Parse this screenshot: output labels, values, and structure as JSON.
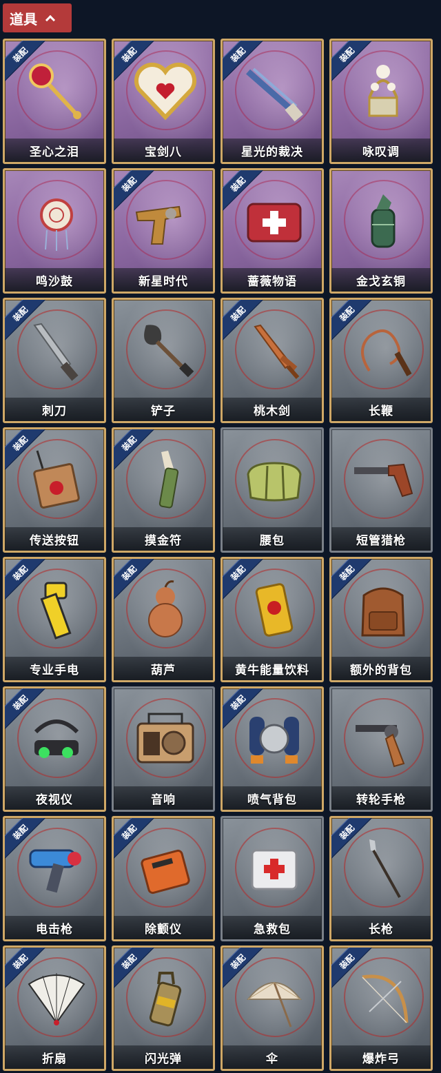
{
  "header": {
    "title": "道具",
    "expanded": true
  },
  "equip_tag": "装配",
  "colors": {
    "header_bg": "#b43a3a",
    "card_border": "#cfa867",
    "tag_bg": "#1f3a6e",
    "page_bg": "#0d1626"
  },
  "items": [
    {
      "name": "圣心之泪",
      "equipped": true,
      "rarity": "purple",
      "icon": "scepter-icon"
    },
    {
      "name": "宝剑八",
      "equipped": true,
      "rarity": "purple",
      "icon": "heart-mirror-icon"
    },
    {
      "name": "星光的裁决",
      "equipped": true,
      "rarity": "purple",
      "icon": "shotgun-icon"
    },
    {
      "name": "咏叹调",
      "equipped": true,
      "rarity": "purple",
      "icon": "music-box-icon"
    },
    {
      "name": "鸣沙鼓",
      "equipped": false,
      "rarity": "purple",
      "icon": "dreamcatcher-drum-icon"
    },
    {
      "name": "新星时代",
      "equipped": true,
      "rarity": "purple",
      "icon": "revolver-icon"
    },
    {
      "name": "蔷薇物语",
      "equipped": true,
      "rarity": "purple",
      "icon": "medkit-case-icon"
    },
    {
      "name": "金戈玄铜",
      "equipped": false,
      "rarity": "purple",
      "icon": "bronze-grenade-icon"
    },
    {
      "name": "刺刀",
      "equipped": true,
      "rarity": "gray",
      "icon": "bayonet-icon"
    },
    {
      "name": "铲子",
      "equipped": false,
      "rarity": "gray",
      "icon": "shovel-icon"
    },
    {
      "name": "桃木剑",
      "equipped": true,
      "rarity": "gray",
      "icon": "wooden-sword-icon"
    },
    {
      "name": "长鞭",
      "equipped": true,
      "rarity": "gray",
      "icon": "whip-icon"
    },
    {
      "name": "传送按钮",
      "equipped": true,
      "rarity": "gray",
      "icon": "teleport-button-icon"
    },
    {
      "name": "摸金符",
      "equipped": true,
      "rarity": "gray",
      "icon": "talisman-icon"
    },
    {
      "name": "腰包",
      "equipped": false,
      "rarity": "plain",
      "icon": "waist-bag-icon"
    },
    {
      "name": "短管猎枪",
      "equipped": false,
      "rarity": "plain",
      "icon": "sawed-off-icon"
    },
    {
      "name": "专业手电",
      "equipped": true,
      "rarity": "gray",
      "icon": "flashlight-icon"
    },
    {
      "name": "葫芦",
      "equipped": true,
      "rarity": "gray",
      "icon": "gourd-icon"
    },
    {
      "name": "黄牛能量饮料",
      "equipped": true,
      "rarity": "gray",
      "icon": "energy-can-icon"
    },
    {
      "name": "额外的背包",
      "equipped": true,
      "rarity": "gray",
      "icon": "backpack-icon"
    },
    {
      "name": "夜视仪",
      "equipped": true,
      "rarity": "gray",
      "icon": "night-vision-icon"
    },
    {
      "name": "音响",
      "equipped": false,
      "rarity": "plain",
      "icon": "radio-icon"
    },
    {
      "name": "喷气背包",
      "equipped": true,
      "rarity": "gray",
      "icon": "jetpack-icon"
    },
    {
      "name": "转轮手枪",
      "equipped": false,
      "rarity": "plain",
      "icon": "revolver-gun-icon"
    },
    {
      "name": "电击枪",
      "equipped": true,
      "rarity": "gray",
      "icon": "taser-icon"
    },
    {
      "name": "除颤仪",
      "equipped": true,
      "rarity": "gray",
      "icon": "defibrillator-icon"
    },
    {
      "name": "急救包",
      "equipped": false,
      "rarity": "plain",
      "icon": "first-aid-kit-icon"
    },
    {
      "name": "长枪",
      "equipped": true,
      "rarity": "gray",
      "icon": "spear-icon"
    },
    {
      "name": "折扇",
      "equipped": true,
      "rarity": "gray",
      "icon": "folding-fan-icon"
    },
    {
      "name": "闪光弹",
      "equipped": true,
      "rarity": "gray",
      "icon": "flashbang-icon"
    },
    {
      "name": "伞",
      "equipped": true,
      "rarity": "gray",
      "icon": "umbrella-icon"
    },
    {
      "name": "爆炸弓",
      "equipped": true,
      "rarity": "gray",
      "icon": "bow-icon"
    }
  ]
}
